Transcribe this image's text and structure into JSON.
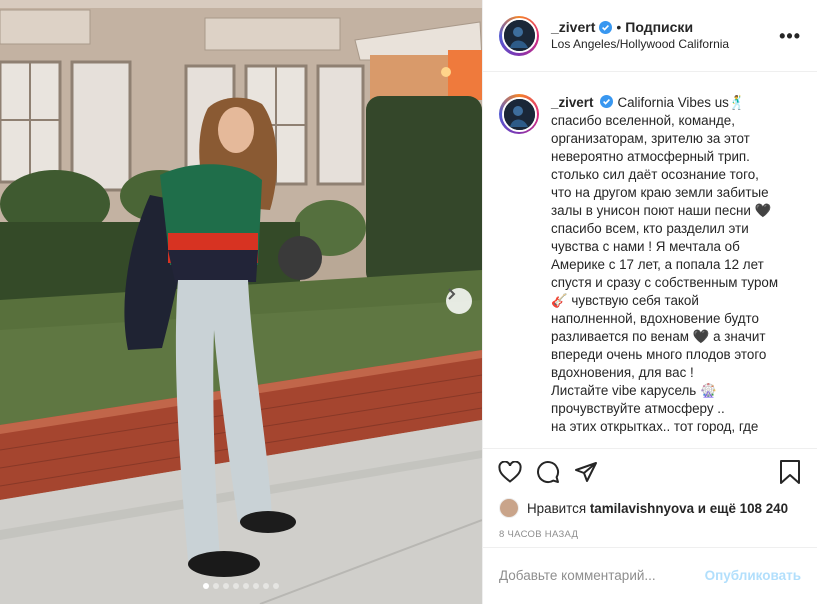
{
  "post": {
    "username": "_zivert",
    "follow_label": "Подписки",
    "separator": "•",
    "location": "Los Angeles/Hollywood California",
    "more_label": "•••",
    "caption_lines": [
      "California Vibes us🕺",
      "спасибо вселенной, команде,",
      "организаторам, зрителю за этот",
      "невероятно атмосферный трип.",
      "столько сил даёт осознание того,",
      "что на другом краю земли забитые",
      "залы в унисон поют наши песни 🖤",
      "спасибо всем, кто разделил эти",
      "чувства с нами ! Я мечтала об",
      "Америке с 17 лет, а попала 12 лет",
      "спустя и сразу с собственным туром",
      "🎸 чувствую себя такой",
      "наполненной, вдохновение будто",
      "разливается по венам 🖤 а значит",
      "впереди очень много плодов этого",
      "вдохновения, для вас !",
      "Листайте vibe карусель 🎡",
      "прочувствуйте атмосферу ..",
      "на этих открытках.. тот город, где"
    ],
    "likes_prefix": "Нравится",
    "likes_user": "tamilavishnyova",
    "likes_suffix": "и ещё 108 240",
    "time_ago": "8 часов назад"
  },
  "comment_box": {
    "placeholder": "Добавьте комментарий...",
    "publish_label": "Опубликовать"
  },
  "carousel": {
    "total_slides": 8,
    "active_index": 0
  },
  "colors": {
    "verified": "#3897f0",
    "publish_disabled": "#b2dffc",
    "muted": "#8e8e8e"
  },
  "icons": [
    "like-icon",
    "comment-icon",
    "share-icon",
    "save-icon",
    "verified-icon",
    "chevron-right-icon",
    "more-icon"
  ]
}
